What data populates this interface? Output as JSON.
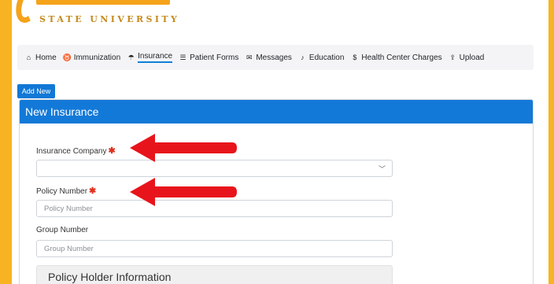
{
  "logo": {
    "text": "STATE UNIVERSITY"
  },
  "nav": [
    {
      "label": "Home",
      "icon": "home-icon",
      "glyph": "⌂"
    },
    {
      "label": "Immunization",
      "icon": "stethoscope-icon",
      "glyph": "♉"
    },
    {
      "label": "Insurance",
      "icon": "umbrella-icon",
      "glyph": "☂"
    },
    {
      "label": "Patient Forms",
      "icon": "list-icon",
      "glyph": "☰"
    },
    {
      "label": "Messages",
      "icon": "envelope-icon",
      "glyph": "✉"
    },
    {
      "label": "Education",
      "icon": "bell-icon",
      "glyph": "♪"
    },
    {
      "label": "Health Center Charges",
      "icon": "dollar-icon",
      "glyph": "$"
    },
    {
      "label": "Upload",
      "icon": "upload-icon",
      "glyph": "⇪"
    }
  ],
  "active_tab": "Insurance",
  "add_new_label": "Add New",
  "card": {
    "title": "New Insurance"
  },
  "form": {
    "insurance_company_label": "Insurance Company",
    "insurance_company_value": "",
    "policy_number_label": "Policy Number",
    "policy_number_placeholder": "Policy Number",
    "group_number_label": "Group Number",
    "group_number_placeholder": "Group Number",
    "required_mark": "✱"
  },
  "section": {
    "title": "Policy Holder Information"
  },
  "colors": {
    "brand_gold": "#f7b322",
    "primary_blue": "#1379d8",
    "arrow_red": "#e8141b",
    "required_red": "#e0301e"
  }
}
